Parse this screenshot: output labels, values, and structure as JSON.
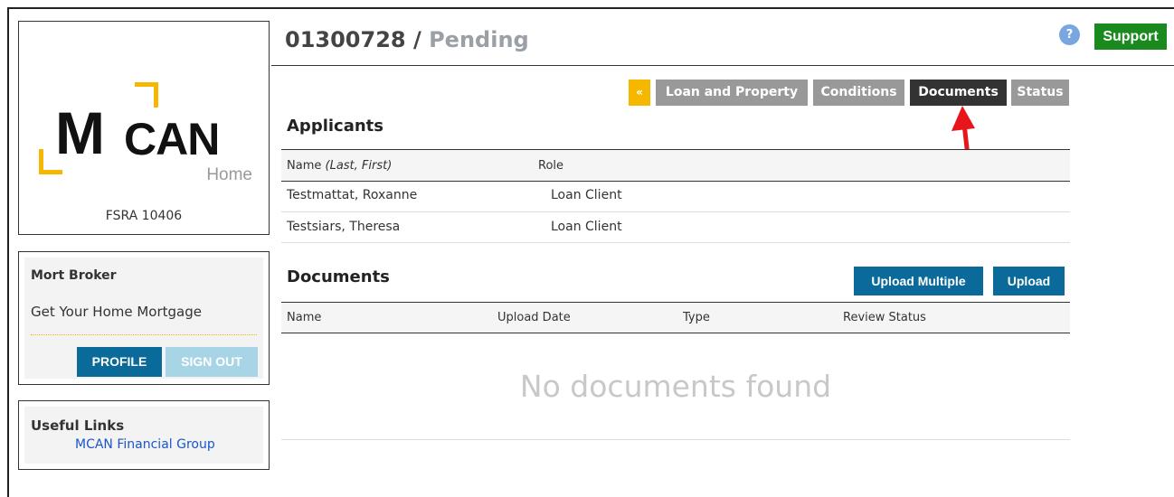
{
  "header": {
    "loan_number": "01300728",
    "separator": " / ",
    "loan_status": "Pending",
    "help_icon": "?",
    "support_label": "Support"
  },
  "sidebar": {
    "logo": {
      "mark": "M",
      "word": "CAN",
      "sub": "Home"
    },
    "license": "FSRA 10406",
    "user": {
      "name": "Mort Broker",
      "tagline": "Get Your Home Mortgage",
      "profile_label": "PROFILE",
      "signout_label": "SIGN OUT"
    },
    "links": {
      "title": "Useful Links",
      "items": [
        {
          "label": "MCAN Financial Group"
        }
      ]
    }
  },
  "tabs": {
    "collapse": "«",
    "items": [
      {
        "label": "Loan and Property"
      },
      {
        "label": "Conditions"
      },
      {
        "label": "Documents",
        "active": true
      },
      {
        "label": "Status"
      }
    ]
  },
  "applicants": {
    "title": "Applicants",
    "columns": {
      "name_main": "Name ",
      "name_hint": "(Last, First)",
      "role": "Role"
    },
    "rows": [
      {
        "name": "Testmattat, Roxanne",
        "role": "Loan Client"
      },
      {
        "name": "Testsiars, Theresa",
        "role": "Loan Client"
      }
    ]
  },
  "documents": {
    "title": "Documents",
    "upload_multiple_label": "Upload Multiple",
    "upload_label": "Upload",
    "columns": [
      "Name",
      "Upload Date",
      "Type",
      "Review Status"
    ],
    "empty_message": "No documents found"
  },
  "colors": {
    "accent_yellow": "#f5b700",
    "primary_blue": "#0a6b9a",
    "support_green": "#1a8a1f",
    "annotation_red": "#e8161b"
  }
}
